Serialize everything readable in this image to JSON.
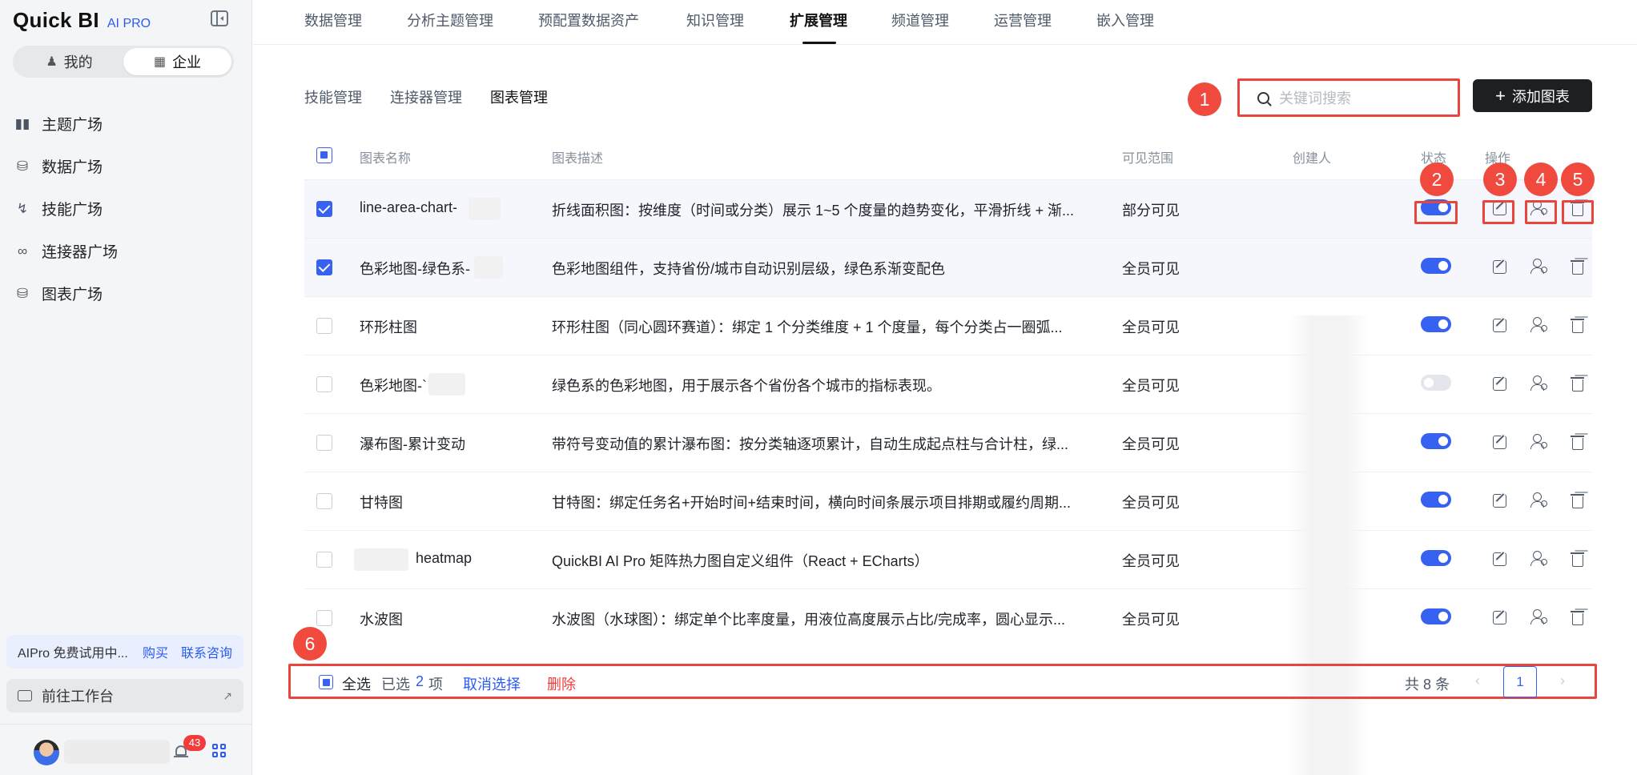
{
  "brand": {
    "name": "Quick BI",
    "tag": "AI PRO"
  },
  "scope": {
    "mine": "我的",
    "enterprise": "企业"
  },
  "sidebar": {
    "items": [
      {
        "label": "主题广场",
        "icon": "books-icon"
      },
      {
        "label": "数据广场",
        "icon": "database-icon"
      },
      {
        "label": "技能广场",
        "icon": "lightning-icon"
      },
      {
        "label": "连接器广场",
        "icon": "connector-icon"
      },
      {
        "label": "图表广场",
        "icon": "chart-db-icon"
      }
    ],
    "trial": {
      "text": "AIPro 免费试用中...",
      "buy": "购买",
      "contact": "联系咨询"
    },
    "goto_workbench": "前往工作台",
    "notifications": "43"
  },
  "topnav": {
    "tabs": [
      "数据管理",
      "分析主题管理",
      "预配置数据资产",
      "知识管理",
      "扩展管理",
      "频道管理",
      "运营管理",
      "嵌入管理"
    ],
    "active": "扩展管理"
  },
  "subnav": {
    "tabs": [
      "技能管理",
      "连接器管理",
      "图表管理"
    ],
    "active": "图表管理"
  },
  "search": {
    "placeholder": "关键词搜索"
  },
  "add_button": {
    "plus": "+",
    "label": "添加图表"
  },
  "table": {
    "headers": {
      "name": "图表名称",
      "desc": "图表描述",
      "scope": "可见范围",
      "creator": "创建人",
      "status": "状态",
      "actions": "操作"
    },
    "rows": [
      {
        "name": "line-area-chart-",
        "desc": "折线面积图：按维度（时间或分类）展示 1~5 个度量的趋势变化，平滑折线 + 渐...",
        "scope": "部分可见",
        "enabled": true,
        "checked": true
      },
      {
        "name": "色彩地图-绿色系-",
        "desc": "色彩地图组件，支持省份/城市自动识别层级，绿色系渐变配色",
        "scope": "全员可见",
        "enabled": true,
        "checked": true
      },
      {
        "name": "环形柱图",
        "desc": "环形柱图（同心圆环赛道）：绑定 1 个分类维度 + 1 个度量，每个分类占一圈弧...",
        "scope": "全员可见",
        "enabled": true,
        "checked": false
      },
      {
        "name": "色彩地图-`",
        "desc": "绿色系的色彩地图，用于展示各个省份各个城市的指标表现。",
        "scope": "全员可见",
        "enabled": false,
        "checked": false
      },
      {
        "name": "瀑布图-累计变动",
        "desc": "带符号变动值的累计瀑布图：按分类轴逐项累计，自动生成起点柱与合计柱，绿...",
        "scope": "全员可见",
        "enabled": true,
        "checked": false
      },
      {
        "name": "甘特图",
        "desc": "甘特图：绑定任务名+开始时间+结束时间，横向时间条展示项目排期或履约周期...",
        "scope": "全员可见",
        "enabled": true,
        "checked": false
      },
      {
        "name": "heatmap",
        "desc": "QuickBI AI Pro 矩阵热力图自定义组件（React + ECharts）",
        "scope": "全员可见",
        "enabled": true,
        "checked": false
      },
      {
        "name": "水波图",
        "desc": "水波图（水球图）：绑定单个比率度量，用液位高度展示占比/完成率，圆心显示...",
        "scope": "全员可见",
        "enabled": true,
        "checked": false
      }
    ]
  },
  "callouts": [
    "1",
    "2",
    "3",
    "4",
    "5",
    "6"
  ],
  "footer": {
    "select_all": "全选",
    "selected_prefix": "已选",
    "selected_count": "2",
    "selected_suffix": "项",
    "cancel": "取消选择",
    "delete": "删除",
    "total": "共 8 条",
    "page": "1",
    "prev": "‹",
    "next": "›"
  },
  "colors": {
    "accent": "#3761f0",
    "annotation": "#e8463c",
    "danger": "#f23c3c",
    "dark_button": "#1d1f22"
  }
}
